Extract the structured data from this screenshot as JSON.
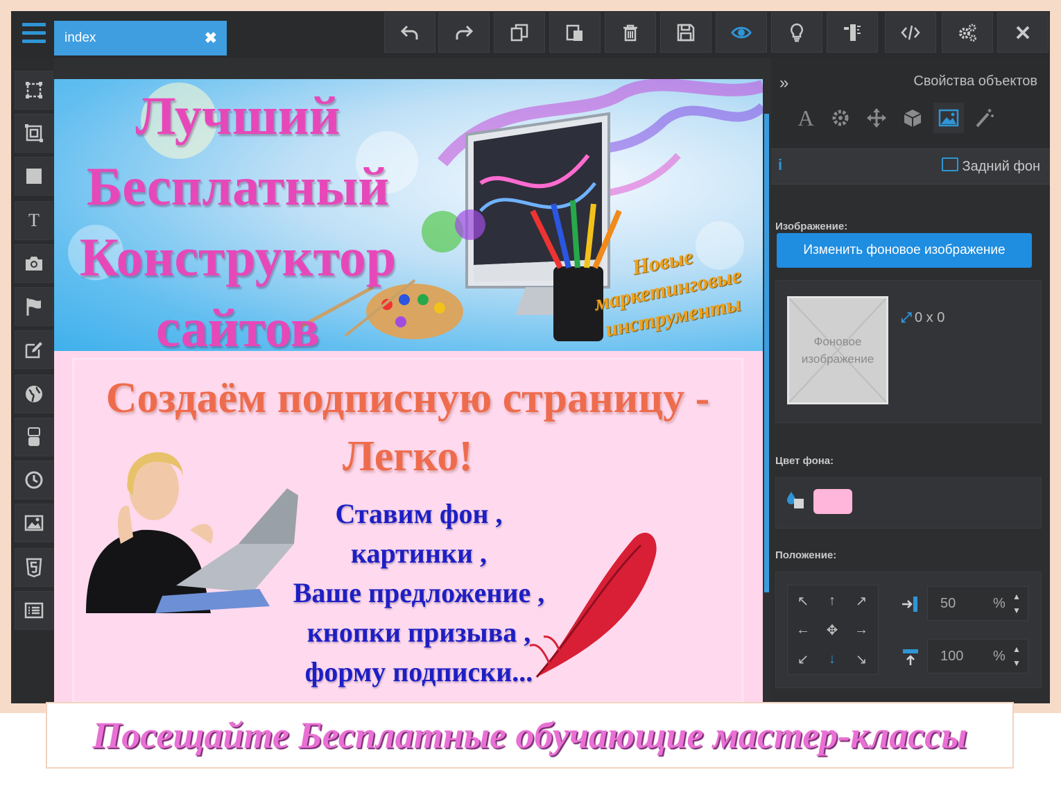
{
  "editor": {
    "tab": {
      "label": "index",
      "close": "✖"
    },
    "toolbar": [
      {
        "name": "undo-button",
        "icon": "undo-icon"
      },
      {
        "name": "redo-button",
        "icon": "redo-icon"
      },
      {
        "name": "copy-button",
        "icon": "copy-icon"
      },
      {
        "name": "paste-button",
        "icon": "paste-icon"
      },
      {
        "name": "delete-button",
        "icon": "trash-icon"
      },
      {
        "name": "save-button",
        "icon": "save-icon"
      },
      {
        "name": "preview-button",
        "icon": "eye-icon"
      },
      {
        "name": "tips-button",
        "icon": "lightbulb-icon"
      },
      {
        "name": "ruler-button",
        "icon": "ruler-icon"
      },
      {
        "name": "code-button",
        "icon": "code-icon"
      },
      {
        "name": "settings-button",
        "icon": "gears-icon"
      },
      {
        "name": "close-button",
        "icon": "close-icon"
      }
    ],
    "sidebar_tools": [
      "select-frame-icon",
      "group-frame-icon",
      "block-icon",
      "text-icon",
      "camera-icon",
      "flag-icon",
      "edit-icon",
      "globe-icon",
      "youtube-icon",
      "clock-icon",
      "image-icon",
      "html5-icon",
      "list-icon"
    ],
    "accent_color": "#2f95d6"
  },
  "page": {
    "banner": {
      "title_lines": [
        "Лучший",
        "Бесплатный",
        "Конструктор",
        "сайтов"
      ],
      "tagline_lines": [
        "Новые",
        "маркетинговые",
        "инструменты"
      ]
    },
    "headline_lines": [
      "Создаём подписную страницу -",
      "Легко!"
    ],
    "features": [
      "Ставим фон ,",
      "картинки ,",
      "Ваше предложение ,",
      "кнопки призыва ,",
      "форму подписки..."
    ],
    "background_color": "#ffd6ec"
  },
  "properties": {
    "title": "Свойства объектов",
    "active_tab": "Задний фон",
    "icons": [
      "font-icon",
      "gear-icon",
      "move-icon",
      "cube-icon",
      "image-icon",
      "magic-wand-icon"
    ],
    "image_label": "Изображение:",
    "change_bg_button": "Изменить фоновое изображение",
    "bg_placeholder_lines": [
      "Фоновое",
      "изображение"
    ],
    "dimensions": "0 x 0",
    "color_label": "Цвет фона:",
    "bg_color": "#ffb6da",
    "position_label": "Положение:",
    "pos_x": "50",
    "pos_y": "100",
    "unit": "%"
  },
  "footer": {
    "caption": "Посещайте Бесплатные обучающие мастер-классы"
  }
}
